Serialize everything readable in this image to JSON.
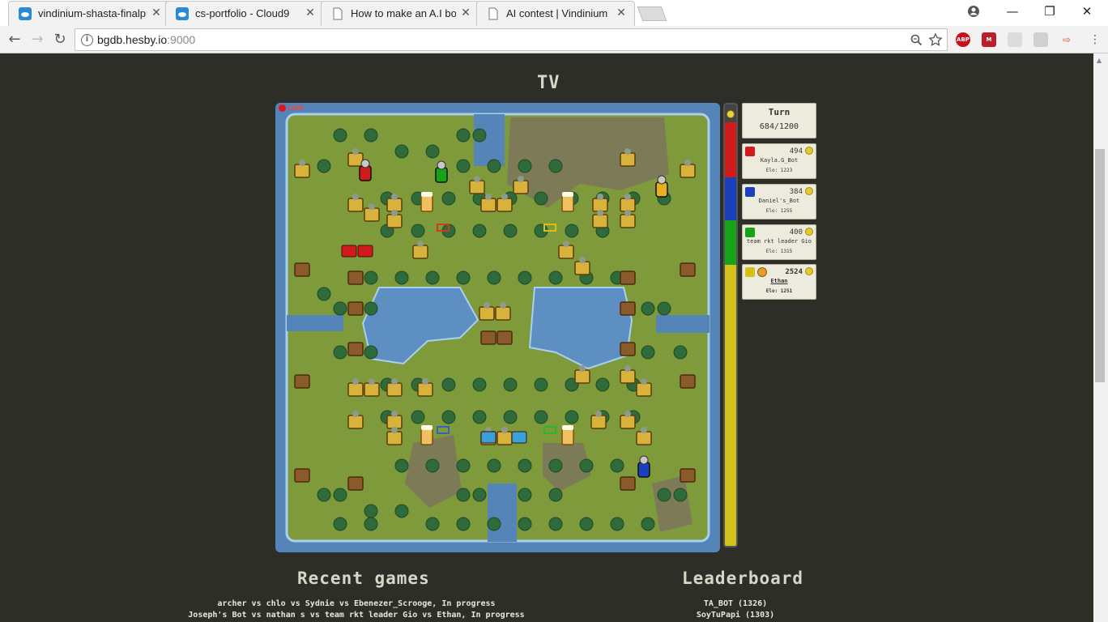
{
  "browser": {
    "tabs": [
      {
        "title": "vindinium-shasta-finalpro",
        "icon": "cloud9-icon"
      },
      {
        "title": "cs-portfolio - Cloud9",
        "icon": "cloud9-icon"
      },
      {
        "title": "How to make an A.I bot",
        "icon": "page-icon"
      },
      {
        "title": "AI contest | Vindinium",
        "icon": "page-icon",
        "active": true
      }
    ],
    "url_host": "bgdb.hesby.io",
    "url_port": ":9000",
    "extensions": {
      "abp": "ABP"
    }
  },
  "page": {
    "tv_heading": "TV",
    "live_label": "LIVE",
    "turn": {
      "label": "Turn",
      "value": "684/1200"
    },
    "players": [
      {
        "gold": "494",
        "name": "Kayla.G_Bot",
        "elo": "Elo: 1223",
        "color": "#d21a1a"
      },
      {
        "gold": "384",
        "name": "Daniel's_Bot",
        "elo": "Elo: 1255",
        "color": "#1a3fbf"
      },
      {
        "gold": "400",
        "name": "team rkt leader Gio",
        "elo": "Elo: 1315",
        "color": "#17a317"
      },
      {
        "gold": "2524",
        "name": "Ethan",
        "elo": "Elo: 1251",
        "color": "#d4c21a"
      }
    ],
    "gold_share": [
      0.1306,
      0.1015,
      0.1057,
      0.6672
    ],
    "recent_heading": "Recent games",
    "recent_games": [
      "archer vs chlo vs Sydnie vs Ebenezer_Scrooge, In progress",
      "Joseph's Bot vs nathan s vs team rkt leader Gio vs Ethan, In progress"
    ],
    "leaderboard_heading": "Leaderboard",
    "leaderboard": [
      "TA_BOT (1326)",
      "SoyTuPapi (1303)"
    ]
  }
}
